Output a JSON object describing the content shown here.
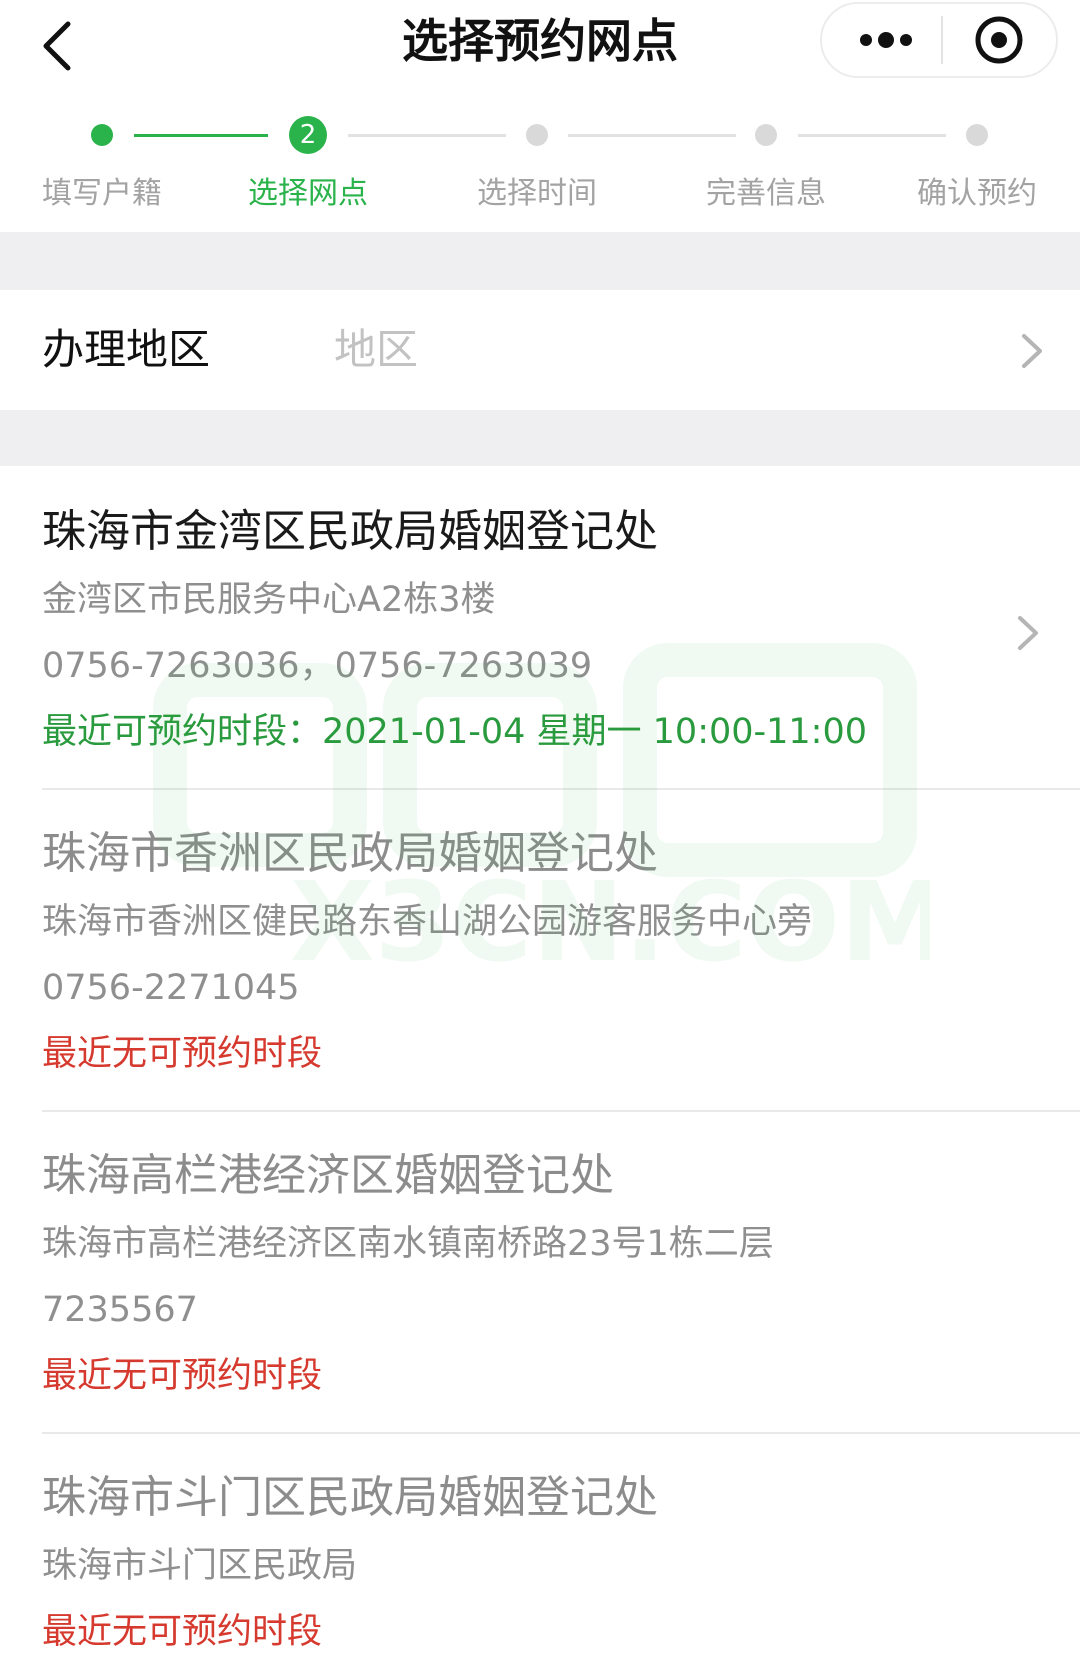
{
  "header": {
    "title": "选择预约网点"
  },
  "steps": [
    {
      "label": "填写户籍",
      "state": "done"
    },
    {
      "label": "选择网点",
      "state": "current",
      "number": "2"
    },
    {
      "label": "选择时间",
      "state": "pending"
    },
    {
      "label": "完善信息",
      "state": "pending"
    },
    {
      "label": "确认预约",
      "state": "pending"
    }
  ],
  "region": {
    "label": "办理地区",
    "placeholder": "地区"
  },
  "offices": [
    {
      "name": "珠海市金湾区民政局婚姻登记处",
      "address": "金湾区市民服务中心A2栋3楼",
      "phone": "0756-7263036，0756-7263039",
      "slot": "最近可预约时段：2021-01-04 星期一 10:00-11:00",
      "available": true
    },
    {
      "name": "珠海市香洲区民政局婚姻登记处",
      "address": "珠海市香洲区健民路东香山湖公园游客服务中心旁",
      "phone": "0756-2271045",
      "slot": "最近无可预约时段",
      "available": false
    },
    {
      "name": "珠海高栏港经济区婚姻登记处",
      "address": "珠海市高栏港经济区南水镇南桥路23号1栋二层",
      "phone": "7235567",
      "slot": "最近无可预约时段",
      "available": false
    },
    {
      "name": "珠海市斗门区民政局婚姻登记处",
      "address": "珠海市斗门区民政局",
      "slot": "最近无可预约时段",
      "available": false
    }
  ],
  "watermark": {
    "text": "X3CN.COM"
  },
  "colors": {
    "accent_green": "#2ab34b",
    "available_text": "#2a9a3e",
    "unavailable_text": "#d63a2f",
    "pending_gray": "#d9d9d9",
    "background_gray": "#efeff1"
  },
  "icons": {
    "back": "chevron-left-icon",
    "more": "more-dots-icon",
    "close": "target-close-icon",
    "arrow": "chevron-right-icon"
  }
}
